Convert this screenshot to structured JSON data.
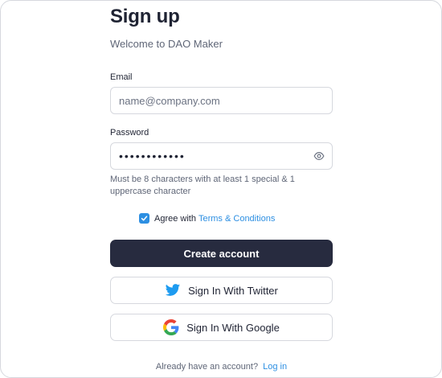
{
  "header": {
    "title": "Sign up",
    "subtitle": "Welcome to DAO Maker"
  },
  "email": {
    "label": "Email",
    "placeholder": "name@company.com",
    "value": ""
  },
  "password": {
    "label": "Password",
    "value": "••••••••••••",
    "icon": "eye-icon",
    "hint": "Must be 8 characters with at least 1 special & 1 uppercase character"
  },
  "agree": {
    "checked": true,
    "text": "Agree with",
    "link": "Terms & Conditions"
  },
  "buttons": {
    "create": "Create account",
    "twitter": "Sign In With Twitter",
    "google": "Sign In With Google"
  },
  "footer": {
    "text": "Already have an account?",
    "link": "Log in"
  },
  "colors": {
    "primary_button": "#272b3f",
    "accent": "#2d8fe2",
    "twitter": "#1d9bf0"
  }
}
